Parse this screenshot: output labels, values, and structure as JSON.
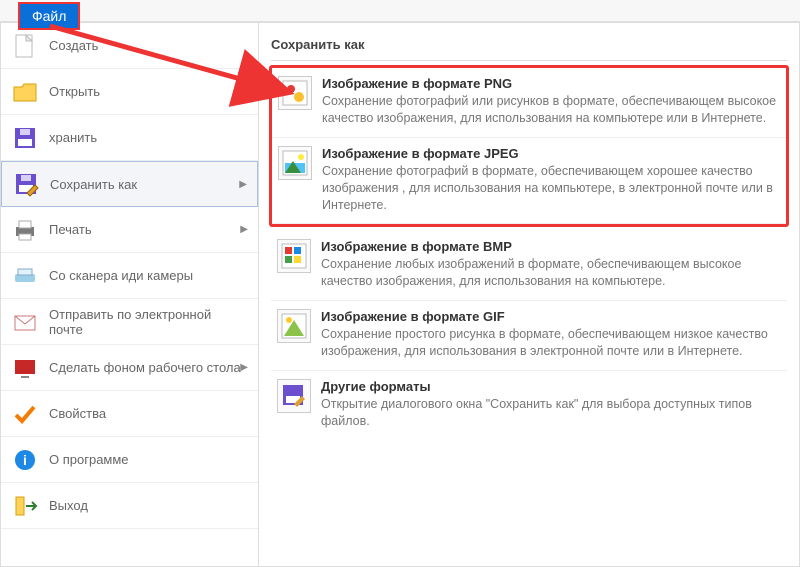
{
  "tab": {
    "file_label": "Файл"
  },
  "left": {
    "items": [
      {
        "label": "Создать"
      },
      {
        "label": "Открыть"
      },
      {
        "label": "хранить"
      },
      {
        "label": "Сохранить как",
        "has_sub": true,
        "active": true
      },
      {
        "label": "Печать",
        "has_sub": true
      },
      {
        "label": "Со сканера иди камеры"
      },
      {
        "label": "Отправить по электронной почте"
      },
      {
        "label": "Сделать фоном рабочего стола",
        "has_sub": true
      },
      {
        "label": "Свойства"
      },
      {
        "label": "О программе"
      },
      {
        "label": "Выход"
      }
    ]
  },
  "right": {
    "title": "Сохранить как",
    "options": [
      {
        "title": "Изображение в формате PNG",
        "desc": "Сохранение фотографий или рисунков в формате, обеспечивающем высокое качество изображения, для использования на компьютере или в Интернете."
      },
      {
        "title": "Изображение в формате JPEG",
        "desc": "Сохранение фотографий в формате, обеспечивающем хорошее качество изображения , для использования на компьютере, в электронной почте или в Интернете."
      },
      {
        "title": "Изображение в формате BMP",
        "desc": "Сохранение любых изображений в формате, обеспечивающем высокое качество изображения, для использования на компьютере."
      },
      {
        "title": "Изображение в формате GIF",
        "desc": "Сохранение простого рисунка в формате, обеспечивающем низкое качество изображения, для использования в электронной почте или в Интернете."
      },
      {
        "title": "Другие форматы",
        "desc": "Открытие диалогового окна \"Сохранить как\" для выбора доступных типов файлов."
      }
    ]
  }
}
